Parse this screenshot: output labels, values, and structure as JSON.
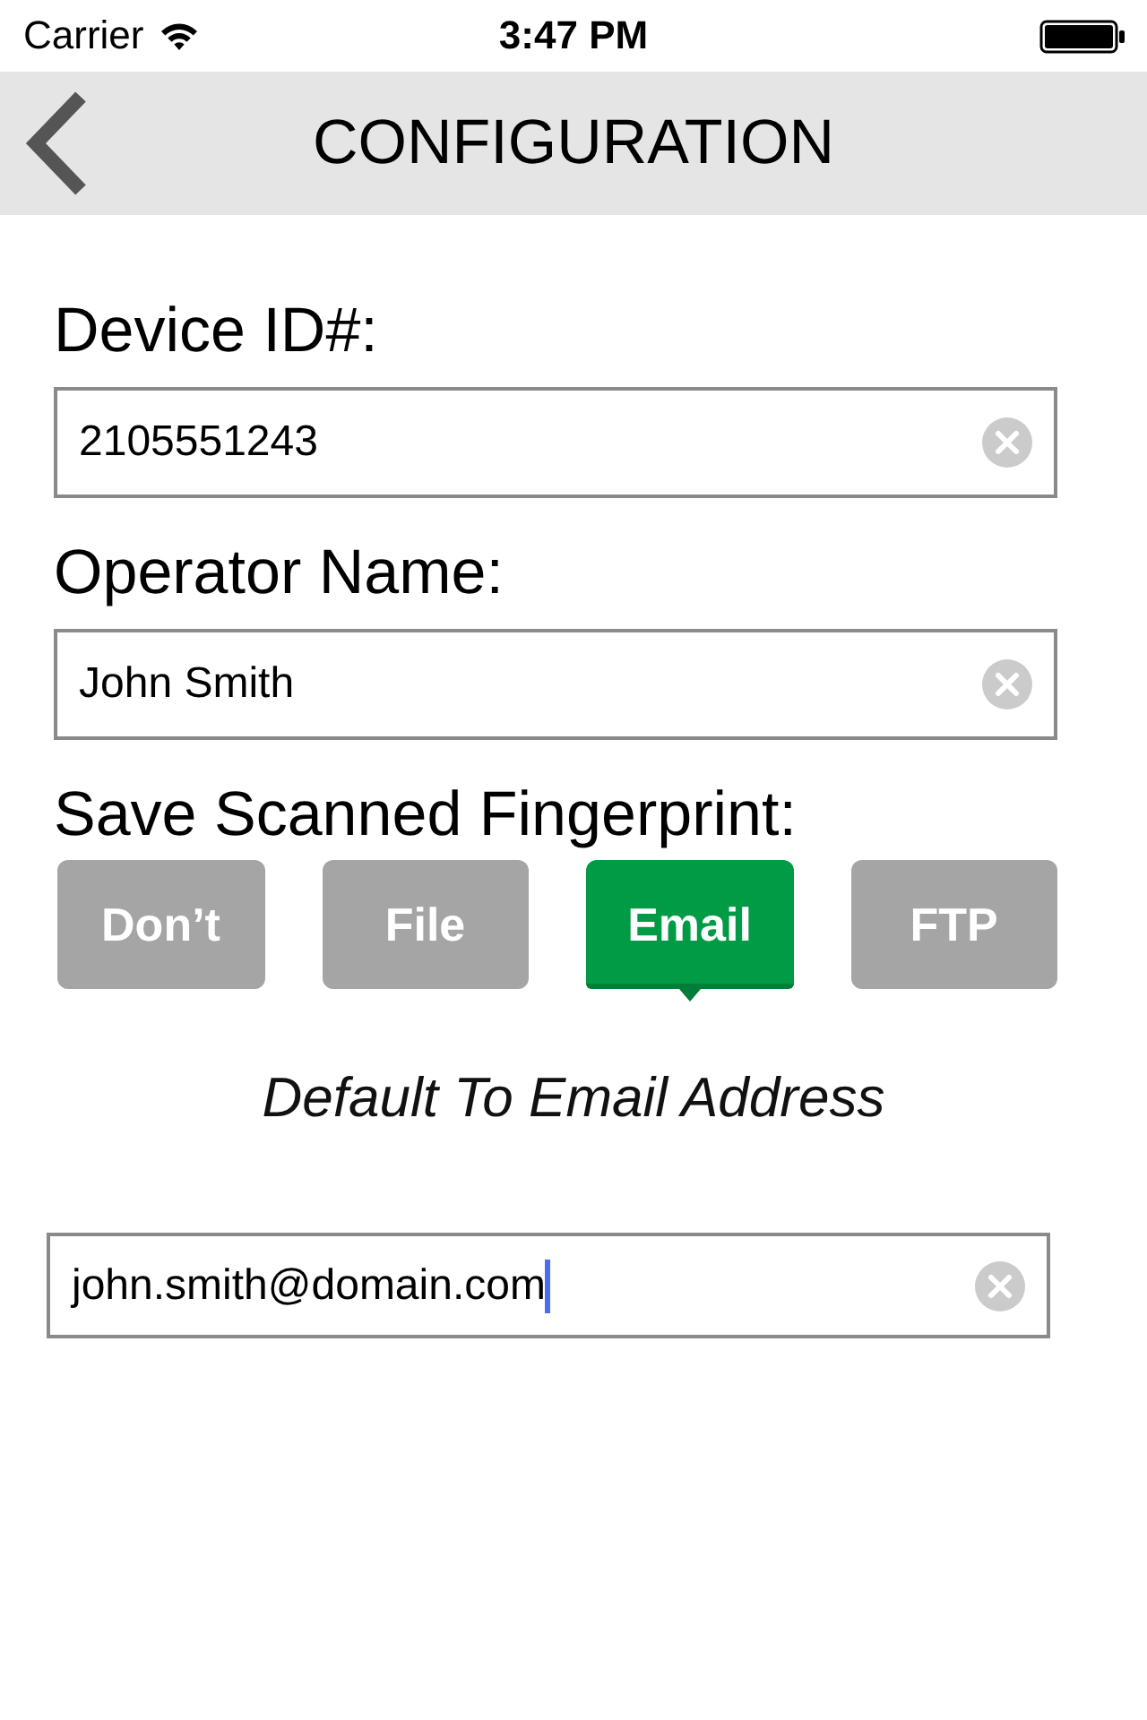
{
  "status_bar": {
    "carrier": "Carrier",
    "time": "3:47 PM"
  },
  "nav_bar": {
    "title": "CONFIGURATION"
  },
  "fields": [
    {
      "label": "Device ID#:",
      "value": "2105551243",
      "focused": false
    },
    {
      "label": "Operator Name:",
      "value": "John Smith",
      "focused": false
    }
  ],
  "save_option": {
    "label": "Save Scanned Fingerprint:",
    "options": [
      {
        "label": "Don’t",
        "selected": false
      },
      {
        "label": "File",
        "selected": false
      },
      {
        "label": "Email",
        "selected": true
      },
      {
        "label": "FTP",
        "selected": false
      }
    ],
    "hint": "Default To Email Address"
  },
  "email_field": {
    "value": "john.smith@domain.com",
    "focused": true
  }
}
